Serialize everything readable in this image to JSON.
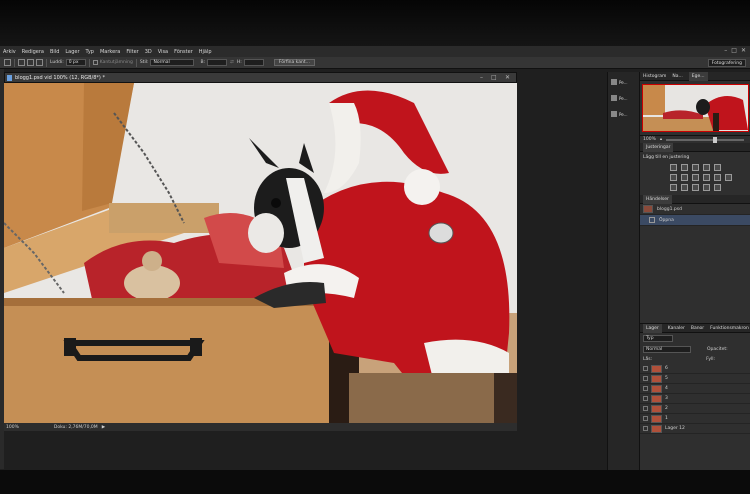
{
  "menubar": {
    "items": [
      "Arkiv",
      "Redigera",
      "Bild",
      "Lager",
      "Typ",
      "Markera",
      "Filter",
      "3D",
      "Visa",
      "Fönster",
      "Hjälp"
    ],
    "window_controls": [
      "–",
      "□",
      "✕"
    ]
  },
  "options": {
    "feather_label": "Luddi:",
    "feather_value": "0 px",
    "antialias_label": "Kantutjämning",
    "style_label": "Stil:",
    "style_value": "Normal",
    "w_label": "B:",
    "h_label": "H:",
    "refine_edge": "Förfina kant...",
    "workspace": "Fotografering"
  },
  "document": {
    "tab_title": "blogg1.psd vid 100% (12, RGB/8*) *",
    "zoom": "100%",
    "doc_size": "Doku: 2,76M/70,0M"
  },
  "dock": {
    "items": [
      "Pe...",
      "Pe...",
      "Pe..."
    ]
  },
  "navigator": {
    "tabs": [
      "Histogram",
      "Na...",
      "Ege..."
    ],
    "zoom": "100%"
  },
  "adjustments": {
    "title": "Justeringar",
    "hint": "Lägg till en justering"
  },
  "history": {
    "title": "Händelser",
    "rows": [
      {
        "label": "blogg1.psd",
        "selected": false,
        "snapshot": true
      },
      {
        "label": "Öppna",
        "selected": true,
        "snapshot": false
      }
    ]
  },
  "layers": {
    "tabs": [
      "Lager",
      "Kanaler",
      "Banor",
      "Funktionsmakron"
    ],
    "kind": "Typ",
    "blend": "Normal",
    "opacity_label": "Opacitet:",
    "lock_label": "Lås:",
    "fill_label": "Fyll:",
    "rows": [
      {
        "name": "6",
        "selected": false
      },
      {
        "name": "5",
        "selected": false
      },
      {
        "name": "4",
        "selected": false
      },
      {
        "name": "3",
        "selected": false
      },
      {
        "name": "2",
        "selected": false
      },
      {
        "name": "1",
        "selected": false
      },
      {
        "name": "Lager 12",
        "selected": false
      }
    ]
  }
}
